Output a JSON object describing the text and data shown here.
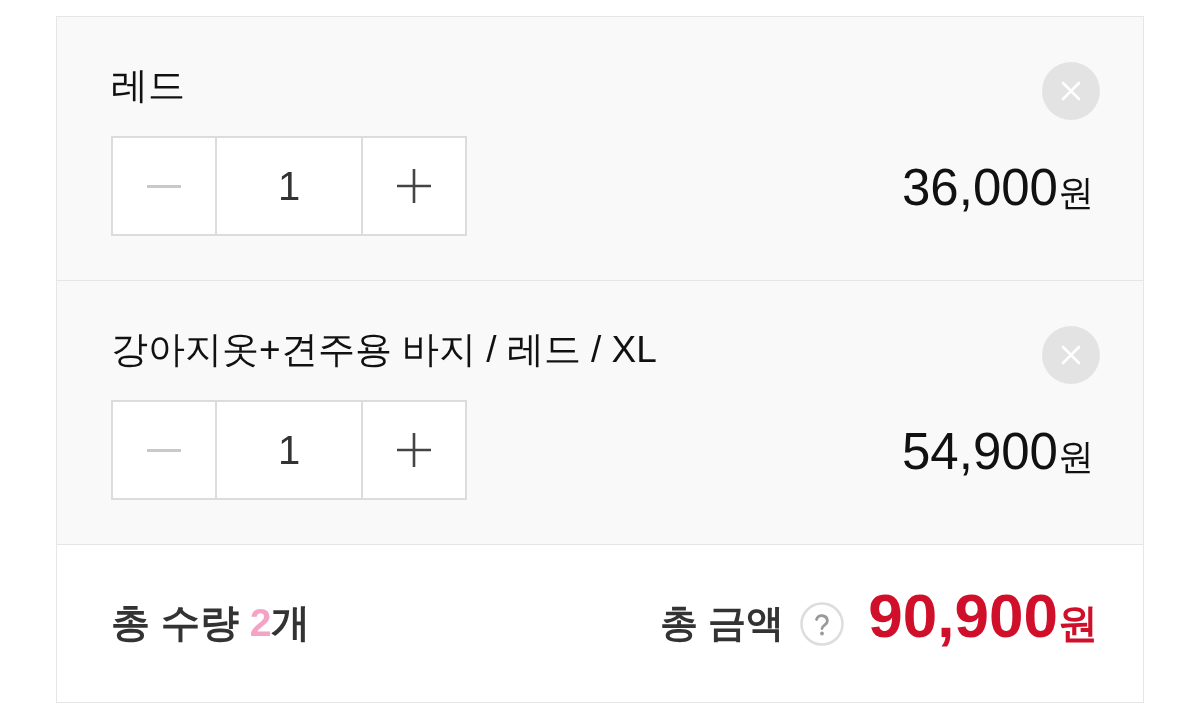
{
  "items": [
    {
      "name": "레드",
      "decrease_disabled": true,
      "quantity": "1",
      "price": "36,000",
      "currency": "원"
    },
    {
      "name": "강아지옷+견주용 바지 / 레드 / XL",
      "decrease_disabled": true,
      "quantity": "1",
      "price": "54,900",
      "currency": "원"
    }
  ],
  "summary": {
    "quantity_label": "총 수량",
    "quantity_count": "2",
    "quantity_unit": "개",
    "amount_label": "총 금액",
    "amount": "90,900",
    "currency": "원"
  }
}
